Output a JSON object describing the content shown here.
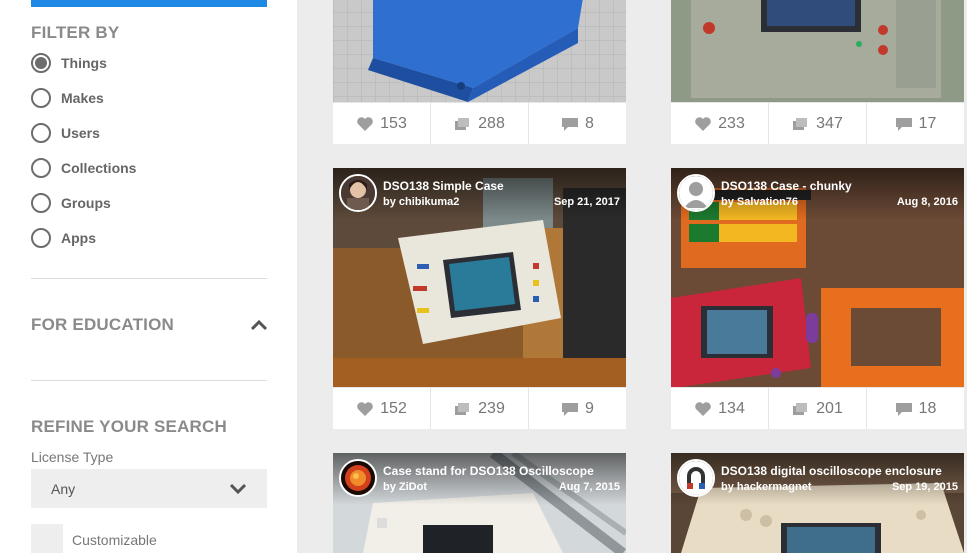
{
  "sidebar": {
    "filter_title": "FILTER BY",
    "filters": [
      {
        "label": "Things",
        "selected": true
      },
      {
        "label": "Makes",
        "selected": false
      },
      {
        "label": "Users",
        "selected": false
      },
      {
        "label": "Collections",
        "selected": false
      },
      {
        "label": "Groups",
        "selected": false
      },
      {
        "label": "Apps",
        "selected": false
      }
    ],
    "education_title": "FOR EDUCATION",
    "refine_title": "REFINE YOUR SEARCH",
    "license_label": "License Type",
    "license_value": "Any",
    "customizable_label": "Customizable"
  },
  "cards": [
    {
      "likes": "153",
      "collects": "288",
      "comments": "8"
    },
    {
      "likes": "233",
      "collects": "347",
      "comments": "17"
    },
    {
      "title": "DSO138 Simple Case",
      "author": "by chibikuma2",
      "date": "Sep 21, 2017",
      "likes": "152",
      "collects": "239",
      "comments": "9"
    },
    {
      "title": "DSO138 Case - chunky",
      "author": "by Salvation76",
      "date": "Aug 8, 2016",
      "likes": "134",
      "collects": "201",
      "comments": "18"
    },
    {
      "title": "Case stand for DSO138 Oscilloscope",
      "author": "by ZiDot",
      "date": "Aug 7, 2015"
    },
    {
      "title": "DSO138 digital oscilloscope enclosure",
      "author": "by hackermagnet",
      "date": "Sep 19, 2015"
    }
  ],
  "colors": {
    "accent": "#1e88e5",
    "icon": "#9e9e9e"
  }
}
